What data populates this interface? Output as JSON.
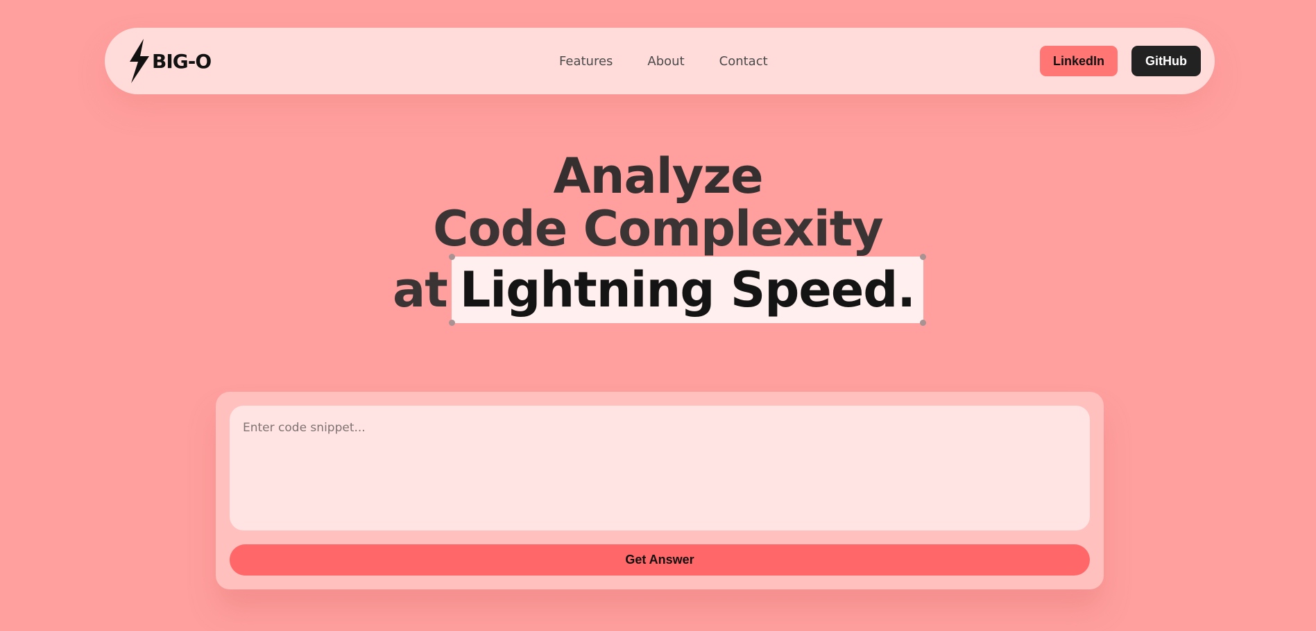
{
  "nav": {
    "logo_text": "BIG-O",
    "logo_icon": "lightning-bolt-icon",
    "links": [
      "Features",
      "About",
      "Contact"
    ],
    "linkedin_label": "LinkedIn",
    "github_label": "GitHub"
  },
  "hero": {
    "line1": "Analyze",
    "line2": "Code Complexity",
    "line3_prefix": "at",
    "line3_highlight": "Lightning Speed."
  },
  "analyzer": {
    "input_value": "",
    "input_placeholder": "Enter code snippet...",
    "submit_label": "Get Answer"
  },
  "colors": {
    "background": "#ffa09e",
    "navbar": "#ffdcda",
    "linkedin_button": "#ff7675",
    "github_button": "#222222",
    "submit_button": "#ff6769",
    "highlight": "#fff0ef"
  }
}
